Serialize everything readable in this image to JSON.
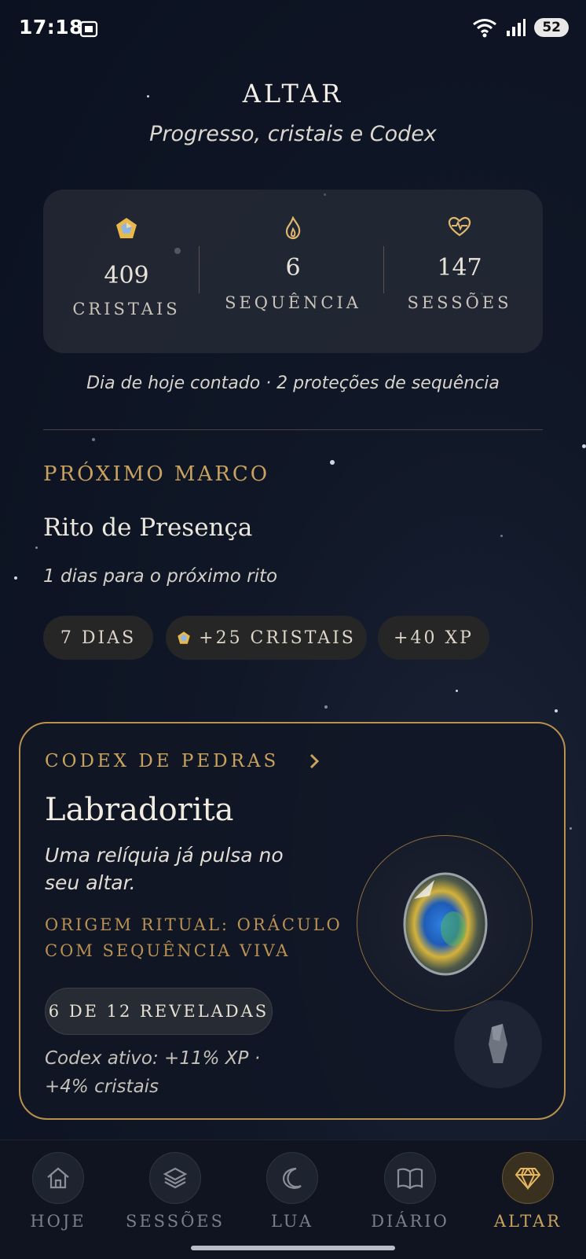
{
  "status": {
    "time": "17:18",
    "battery": "52"
  },
  "header": {
    "title": "ALTAR",
    "subtitle": "Progresso, cristais e Codex"
  },
  "stats": [
    {
      "value": "409",
      "label": "CRISTAIS",
      "icon": "crystal-icon"
    },
    {
      "value": "6",
      "label": "SEQUÊNCIA",
      "icon": "flame-icon"
    },
    {
      "value": "147",
      "label": "SESSÕES",
      "icon": "heart-pulse-icon"
    }
  ],
  "protection_text": "Dia de hoje contado · 2 proteções de sequência",
  "next_milestone": {
    "heading": "PRÓXIMO MARCO",
    "name": "Rito de Presença",
    "days_text": "1 dias para o próximo rito",
    "pills": [
      "7 DIAS",
      "+25 CRISTAIS",
      "+40 XP"
    ]
  },
  "codex": {
    "heading": "CODEX DE PEDRAS",
    "stone_name": "Labradorita",
    "description": "Uma relíquia já pulsa no seu altar.",
    "origin": "ORIGEM RITUAL: ORÁCULO COM SEQUÊNCIA VIVA",
    "revealed": "6 DE 12 REVELADAS",
    "bonus": "Codex ativo: +11% XP · +4% cristais"
  },
  "nav": [
    {
      "label": "HOJE",
      "icon": "home-icon",
      "active": false
    },
    {
      "label": "SESSÕES",
      "icon": "layers-icon",
      "active": false
    },
    {
      "label": "LUA",
      "icon": "moon-icon",
      "active": false
    },
    {
      "label": "DIÁRIO",
      "icon": "book-icon",
      "active": false
    },
    {
      "label": "ALTAR",
      "icon": "diamond-icon",
      "active": true
    }
  ],
  "colors": {
    "accent_gold": "#c9a25e",
    "background": "#0b1120"
  }
}
